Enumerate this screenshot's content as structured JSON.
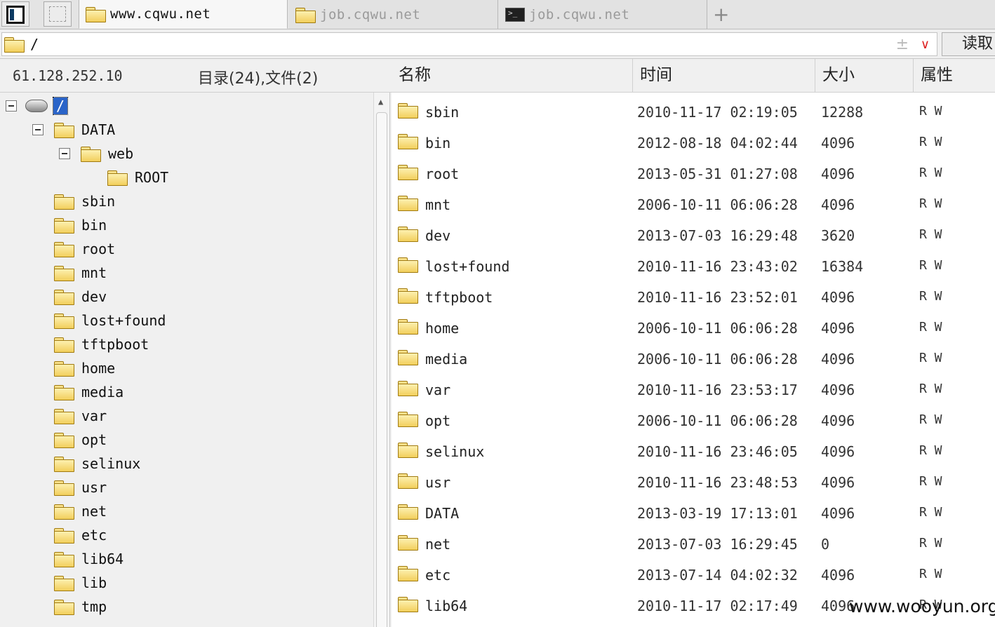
{
  "tabs": [
    {
      "label": "www.cqwu.net",
      "icon": "folder-icon",
      "active": true
    },
    {
      "label": "job.cqwu.net",
      "icon": "folder-icon",
      "active": false
    },
    {
      "label": "job.cqwu.net",
      "icon": "terminal-icon",
      "active": false
    }
  ],
  "address": {
    "path": "/",
    "read_label": "读取"
  },
  "info": {
    "ip": "61.128.252.10",
    "counts": "目录(24),文件(2)"
  },
  "columns": {
    "name": "名称",
    "time": "时间",
    "size": "大小",
    "attr": "属性"
  },
  "tree": {
    "root_label": "/",
    "data_label": "DATA",
    "web_label": "web",
    "root_dir_label": "ROOT",
    "items": [
      "sbin",
      "bin",
      "root",
      "mnt",
      "dev",
      "lost+found",
      "tftpboot",
      "home",
      "media",
      "var",
      "opt",
      "selinux",
      "usr",
      "net",
      "etc",
      "lib64",
      "lib",
      "tmp"
    ]
  },
  "files": [
    {
      "name": "sbin",
      "time": "2010-11-17 02:19:05",
      "size": "12288",
      "attr": "R W"
    },
    {
      "name": "bin",
      "time": "2012-08-18 04:02:44",
      "size": "4096",
      "attr": "R W"
    },
    {
      "name": "root",
      "time": "2013-05-31 01:27:08",
      "size": "4096",
      "attr": "R W"
    },
    {
      "name": "mnt",
      "time": "2006-10-11 06:06:28",
      "size": "4096",
      "attr": "R W"
    },
    {
      "name": "dev",
      "time": "2013-07-03 16:29:48",
      "size": "3620",
      "attr": "R W"
    },
    {
      "name": "lost+found",
      "time": "2010-11-16 23:43:02",
      "size": "16384",
      "attr": "R W"
    },
    {
      "name": "tftpboot",
      "time": "2010-11-16 23:52:01",
      "size": "4096",
      "attr": "R W"
    },
    {
      "name": "home",
      "time": "2006-10-11 06:06:28",
      "size": "4096",
      "attr": "R W"
    },
    {
      "name": "media",
      "time": "2006-10-11 06:06:28",
      "size": "4096",
      "attr": "R W"
    },
    {
      "name": "var",
      "time": "2010-11-16 23:53:17",
      "size": "4096",
      "attr": "R W"
    },
    {
      "name": "opt",
      "time": "2006-10-11 06:06:28",
      "size": "4096",
      "attr": "R W"
    },
    {
      "name": "selinux",
      "time": "2010-11-16 23:46:05",
      "size": "4096",
      "attr": "R W"
    },
    {
      "name": "usr",
      "time": "2010-11-16 23:48:53",
      "size": "4096",
      "attr": "R W"
    },
    {
      "name": "DATA",
      "time": "2013-03-19 17:13:01",
      "size": "4096",
      "attr": "R W"
    },
    {
      "name": "net",
      "time": "2013-07-03 16:29:45",
      "size": "0",
      "attr": "R W"
    },
    {
      "name": "etc",
      "time": "2013-07-14 04:02:32",
      "size": "4096",
      "attr": "R W"
    },
    {
      "name": "lib64",
      "time": "2010-11-17 02:17:49",
      "size": "4096",
      "attr": "R W"
    }
  ],
  "watermark": "www.wooyun.org"
}
